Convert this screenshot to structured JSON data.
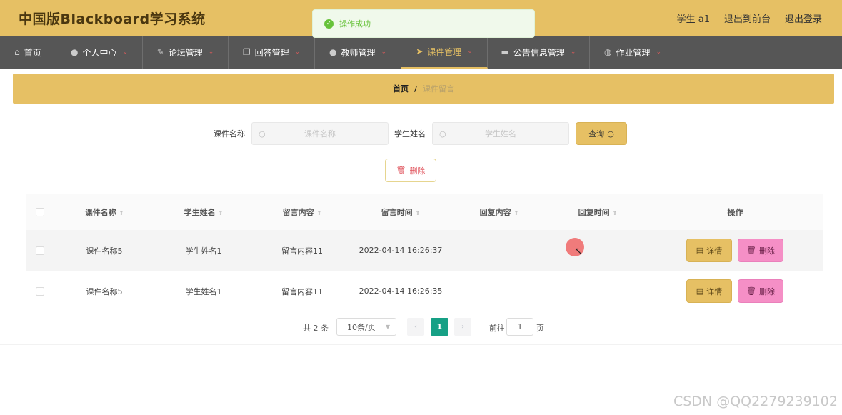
{
  "app": {
    "title": "中国版Blackboard学习系统"
  },
  "header": {
    "user": "学生 a1",
    "to_front": "退出到前台",
    "logout": "退出登录"
  },
  "toast": {
    "message": "操作成功",
    "color": "#67c23a"
  },
  "nav": {
    "items": [
      {
        "label": "首页",
        "icon": "home-icon"
      },
      {
        "label": "个人中心",
        "icon": "user-icon"
      },
      {
        "label": "论坛管理",
        "icon": "forum-icon"
      },
      {
        "label": "回答管理",
        "icon": "copy-icon"
      },
      {
        "label": "教师管理",
        "icon": "user-icon"
      },
      {
        "label": "课件管理",
        "icon": "send-icon",
        "active": true
      },
      {
        "label": "公告信息管理",
        "icon": "chat-icon"
      },
      {
        "label": "作业管理",
        "icon": "globe-icon"
      }
    ]
  },
  "breadcrumb": {
    "home": "首页",
    "separator": "/",
    "current": "课件留言"
  },
  "search": {
    "course_label": "课件名称",
    "course_placeholder": "课件名称",
    "student_label": "学生姓名",
    "student_placeholder": "学生姓名",
    "query_label": "查询"
  },
  "actions": {
    "delete_label": "删除"
  },
  "table": {
    "columns": [
      "课件名称",
      "学生姓名",
      "留言内容",
      "留言时间",
      "回复内容",
      "回复时间",
      "操作"
    ],
    "rows": [
      {
        "course": "课件名称5",
        "student": "学生姓名1",
        "content": "留言内容11",
        "time": "2022-04-14 16:26:37",
        "reply": "",
        "reply_time": ""
      },
      {
        "course": "课件名称5",
        "student": "学生姓名1",
        "content": "留言内容11",
        "time": "2022-04-14 16:26:35",
        "reply": "",
        "reply_time": ""
      }
    ],
    "detail_label": "详情",
    "delete_label": "删除"
  },
  "pagination": {
    "total": "共 2 条",
    "page_size": "10条/页",
    "current_page": "1",
    "goto_label": "前往",
    "goto_value": "1",
    "page_suffix": "页"
  },
  "watermark": "CSDN @QQ2279239102",
  "colors": {
    "accent": "#e6c064",
    "nav_bg": "#565656",
    "delete_pink": "#f58fc6",
    "page_active": "#16a085"
  }
}
